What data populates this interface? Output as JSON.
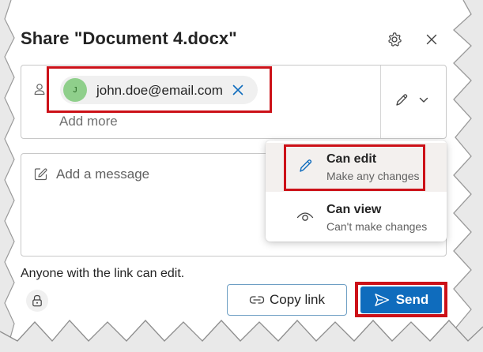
{
  "dialog": {
    "title": "Share \"Document 4.docx\""
  },
  "recipients": {
    "chip_avatar_initial": "J",
    "chip_email": "john.doe@email.com",
    "add_more_placeholder": "Add more"
  },
  "message": {
    "placeholder": "Add a message"
  },
  "permissions": {
    "selected": "Can edit",
    "options": [
      {
        "title": "Can edit",
        "description": "Make any changes"
      },
      {
        "title": "Can view",
        "description": "Can't make changes"
      }
    ]
  },
  "footer": {
    "link_note": "Anyone with the link can edit.",
    "copy_link_label": "Copy link",
    "send_label": "Send"
  },
  "colors": {
    "accent": "#0f6cbd",
    "highlight_box": "#cc1118",
    "avatar_bg": "#8fcf8b"
  },
  "icons": {
    "settings": "gear-icon",
    "close": "close-icon",
    "people": "person-icon",
    "remove_recipient": "close-icon",
    "permission_toggle": "pencil-icon",
    "dropdown": "chevron-down-icon",
    "message": "compose-icon",
    "can_edit": "pencil-icon",
    "can_view": "eye-icon",
    "link_settings": "lock-icon",
    "copy_link": "link-icon",
    "send": "send-icon"
  }
}
